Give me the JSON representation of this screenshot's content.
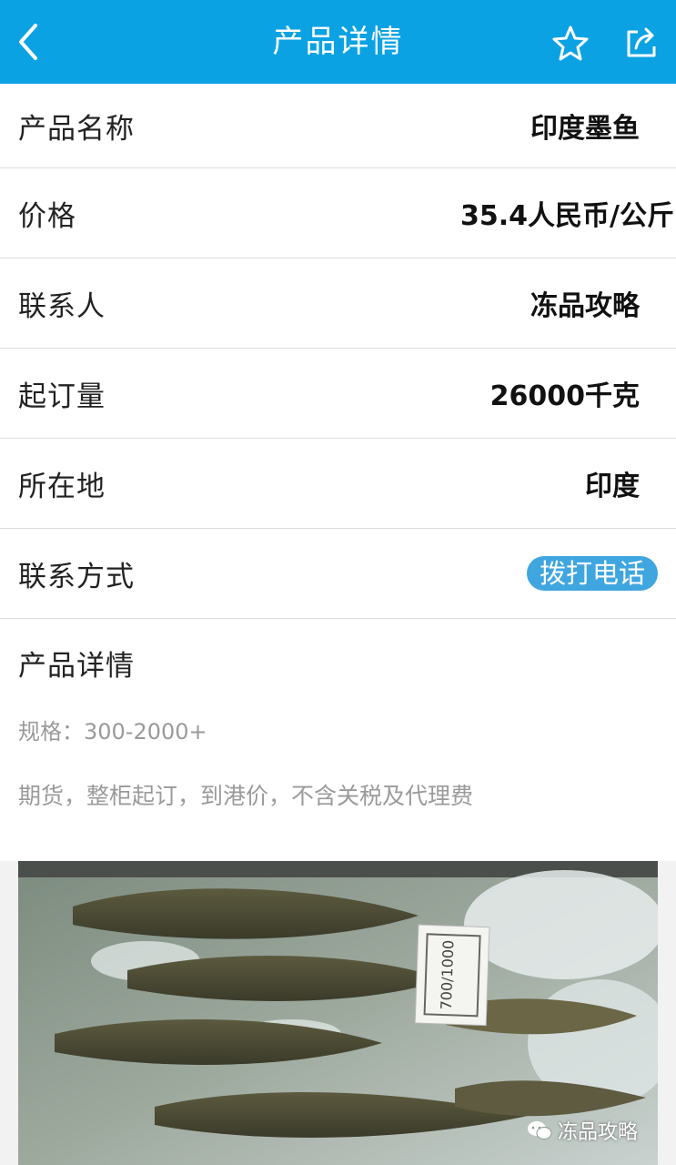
{
  "header": {
    "title": "产品详情",
    "back_icon": "back-arrow-icon",
    "star_icon": "star-icon",
    "share_icon": "share-icon",
    "color": "#0aa2e3"
  },
  "fields": [
    {
      "label": "产品名称",
      "value": "印度墨鱼"
    },
    {
      "label": "价格",
      "value": "35.4人民币/公斤"
    },
    {
      "label": "联系人",
      "value": "冻品攻略"
    },
    {
      "label": "起订量",
      "value": "26000千克"
    },
    {
      "label": "所在地",
      "value": "印度"
    },
    {
      "label": "联系方式",
      "value": "拨打电话"
    }
  ],
  "detail": {
    "heading": "产品详情",
    "spec": "规格：300-2000+",
    "note": "期货，整柜起订，到港价，不含关税及代理费"
  },
  "photo": {
    "tag_text": "700/1000",
    "watermark": "冻品攻略"
  }
}
